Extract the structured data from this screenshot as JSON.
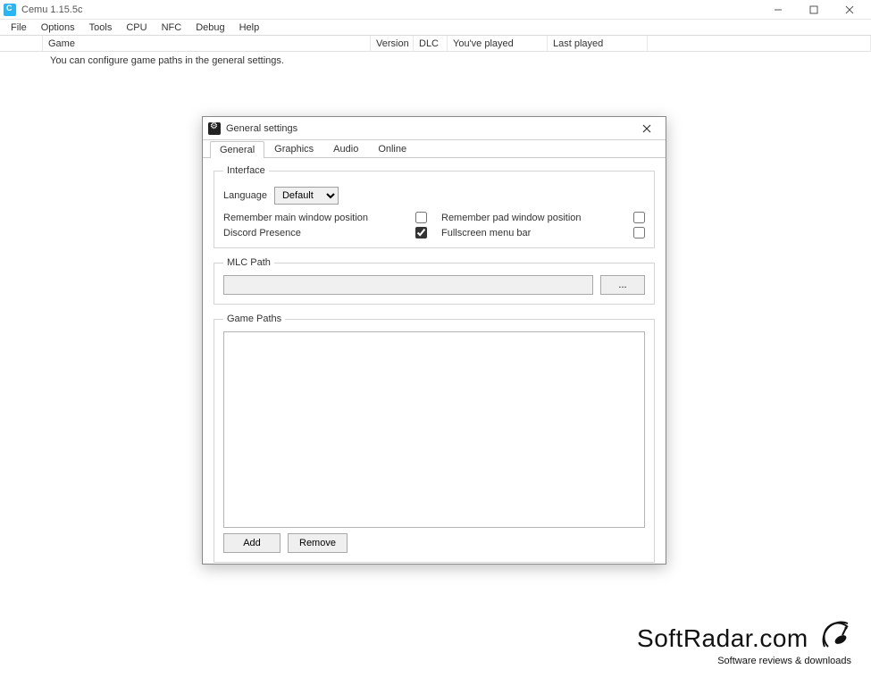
{
  "window": {
    "title": "Cemu 1.15.5c"
  },
  "menu": {
    "items": [
      "File",
      "Options",
      "Tools",
      "CPU",
      "NFC",
      "Debug",
      "Help"
    ]
  },
  "list": {
    "columns": {
      "game": "Game",
      "version": "Version",
      "dlc": "DLC",
      "played": "You've played",
      "last": "Last played"
    },
    "hint": "You can configure game paths in the general settings."
  },
  "dialog": {
    "title": "General settings",
    "tabs": {
      "general": "General",
      "graphics": "Graphics",
      "audio": "Audio",
      "online": "Online"
    },
    "interface": {
      "legend": "Interface",
      "language_label": "Language",
      "language_value": "Default",
      "remember_main_label": "Remember main window position",
      "remember_main_checked": false,
      "discord_label": "Discord Presence",
      "discord_checked": true,
      "remember_pad_label": "Remember pad window position",
      "remember_pad_checked": false,
      "fullscreen_menu_label": "Fullscreen menu bar",
      "fullscreen_menu_checked": false
    },
    "mlc": {
      "legend": "MLC Path",
      "value": "",
      "browse_label": "..."
    },
    "game_paths": {
      "legend": "Game Paths",
      "add_label": "Add",
      "remove_label": "Remove"
    }
  },
  "watermark": {
    "brand": "SoftRadar.com",
    "tagline": "Software reviews & downloads"
  }
}
